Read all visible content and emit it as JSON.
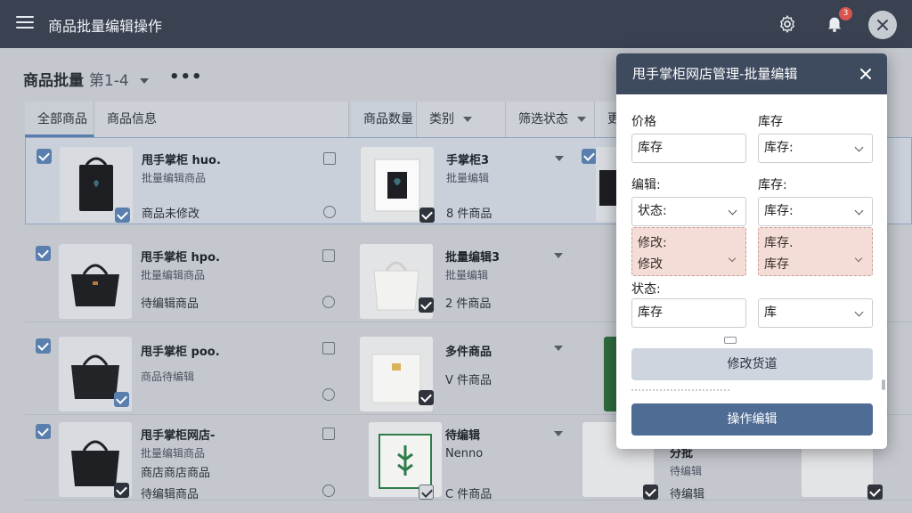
{
  "topbar": {
    "title": "商品批量编辑操作",
    "notification_count": "3"
  },
  "toolbar": {
    "breadcrumb_main": "商品批量",
    "breadcrumb_sub": "第1-4",
    "more": "•••"
  },
  "columns": [
    {
      "label": "全部商品"
    },
    {
      "label": "商品信息"
    },
    {
      "label": "商品数量"
    },
    {
      "label": "类别"
    },
    {
      "label": "筛选状态"
    },
    {
      "label": "更"
    }
  ],
  "rows": [
    {
      "title": "甩手掌柜 huo.",
      "subtitle": "批量编辑商品",
      "status": "商品未修改",
      "col2_title": "手掌柜3",
      "col2_sub": "批量编辑",
      "col2_qty": "8 件商品"
    },
    {
      "title": "甩手掌柜 hpo.",
      "subtitle": "批量编辑商品",
      "status": "待编辑商品",
      "col2_title": "批量编辑3",
      "col2_sub": "批量编辑",
      "col2_qty": "2 件商品"
    },
    {
      "title": "甩手掌柜 poo.",
      "subtitle": "商品待编辑",
      "status": "",
      "col2_title": "多件商品",
      "col2_sub": "",
      "col2_qty": "V 件商品"
    },
    {
      "title": "甩手掌柜网店-",
      "subtitle": "批量编辑商品",
      "status": "商店商店商品",
      "status2": "待编辑商品",
      "col2_title": "待编辑",
      "col2_sub": "Nenno",
      "col2_qty": "C 件商品",
      "col3_a": "分批",
      "col3_b": "待编辑",
      "col3_c": "待编辑"
    }
  ],
  "modal": {
    "title": "甩手掌柜网店管理-批量编辑",
    "price_label": "价格",
    "stock_label": "库存",
    "price_value": "库存",
    "stock_select": "库存:",
    "label_r2_left": "编辑:",
    "label_r2_right": "库存:",
    "select_r2_left": "状态:",
    "select_r2_right": "库存:",
    "hl_left_1": "修改:",
    "hl_left_2": "修改",
    "hl_right_1": "库存.",
    "hl_right_2": "库存",
    "label_r4": "状态:",
    "input_r4": "库存",
    "select_r4": "库",
    "secondary_button": "修改货道",
    "primary_button": "操作编辑"
  },
  "colors": {
    "topbar": "#3a4252",
    "accent": "#4f6d94",
    "highlight": "#f3ddd6"
  }
}
